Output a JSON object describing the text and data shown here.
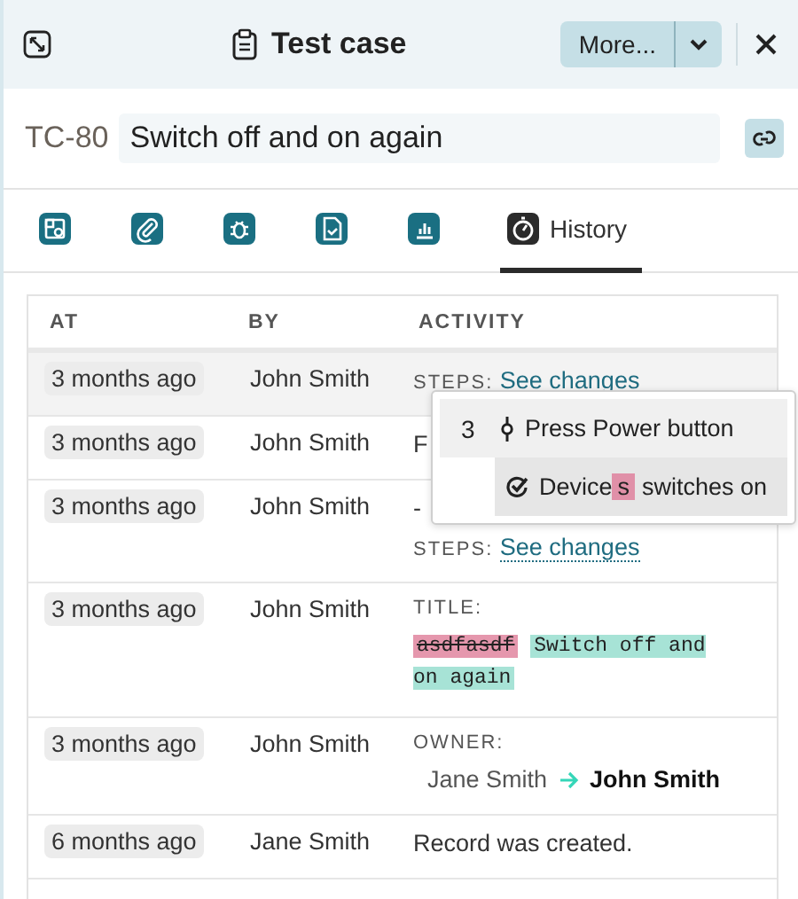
{
  "header": {
    "title": "Test case",
    "more_button": "More..."
  },
  "record": {
    "id": "TC-80",
    "title": "Switch off and on again"
  },
  "tabs": [
    {
      "selected": false
    },
    {
      "selected": false
    },
    {
      "selected": false
    },
    {
      "selected": false
    },
    {
      "selected": false
    },
    {
      "label": "History",
      "selected": true
    }
  ],
  "table": {
    "columns": [
      "AT",
      "BY",
      "ACTIVITY"
    ],
    "rows": [
      {
        "at": "3 months ago",
        "by": "John Smith",
        "hovered": true,
        "activity": [
          {
            "kind": "link",
            "label": "STEPS:",
            "link": "See changes"
          }
        ]
      },
      {
        "at": "3 months ago",
        "by": "John Smith",
        "hovered": false,
        "activity": [
          {
            "kind": "text",
            "text": "F"
          }
        ]
      },
      {
        "at": "3 months ago",
        "by": "John Smith",
        "hovered": false,
        "activity": [
          {
            "kind": "text",
            "text": "-"
          },
          {
            "kind": "link",
            "label": "STEPS:",
            "link": "See changes"
          }
        ]
      },
      {
        "at": "3 months ago",
        "by": "John Smith",
        "hovered": false,
        "activity": [
          {
            "kind": "diff",
            "label": "TITLE:",
            "removed": "asdfasdf",
            "added": "Switch off and on again"
          }
        ]
      },
      {
        "at": "3 months ago",
        "by": "John Smith",
        "hovered": false,
        "activity": [
          {
            "kind": "change",
            "label": "OWNER:",
            "from": "Jane Smith",
            "to": "John Smith"
          }
        ]
      },
      {
        "at": "6 months ago",
        "by": "Jane Smith",
        "hovered": false,
        "activity": [
          {
            "kind": "text",
            "text": "Record was created."
          }
        ]
      }
    ]
  },
  "popup": {
    "rows": [
      {
        "kind": "step",
        "number": "3",
        "parts": [
          {
            "text": "Press Power button",
            "removed": false
          }
        ]
      },
      {
        "kind": "expected",
        "parts": [
          {
            "text": "Device",
            "removed": false
          },
          {
            "text": "s",
            "removed": true
          },
          {
            "text": "switches on",
            "removed": false
          }
        ]
      }
    ]
  }
}
